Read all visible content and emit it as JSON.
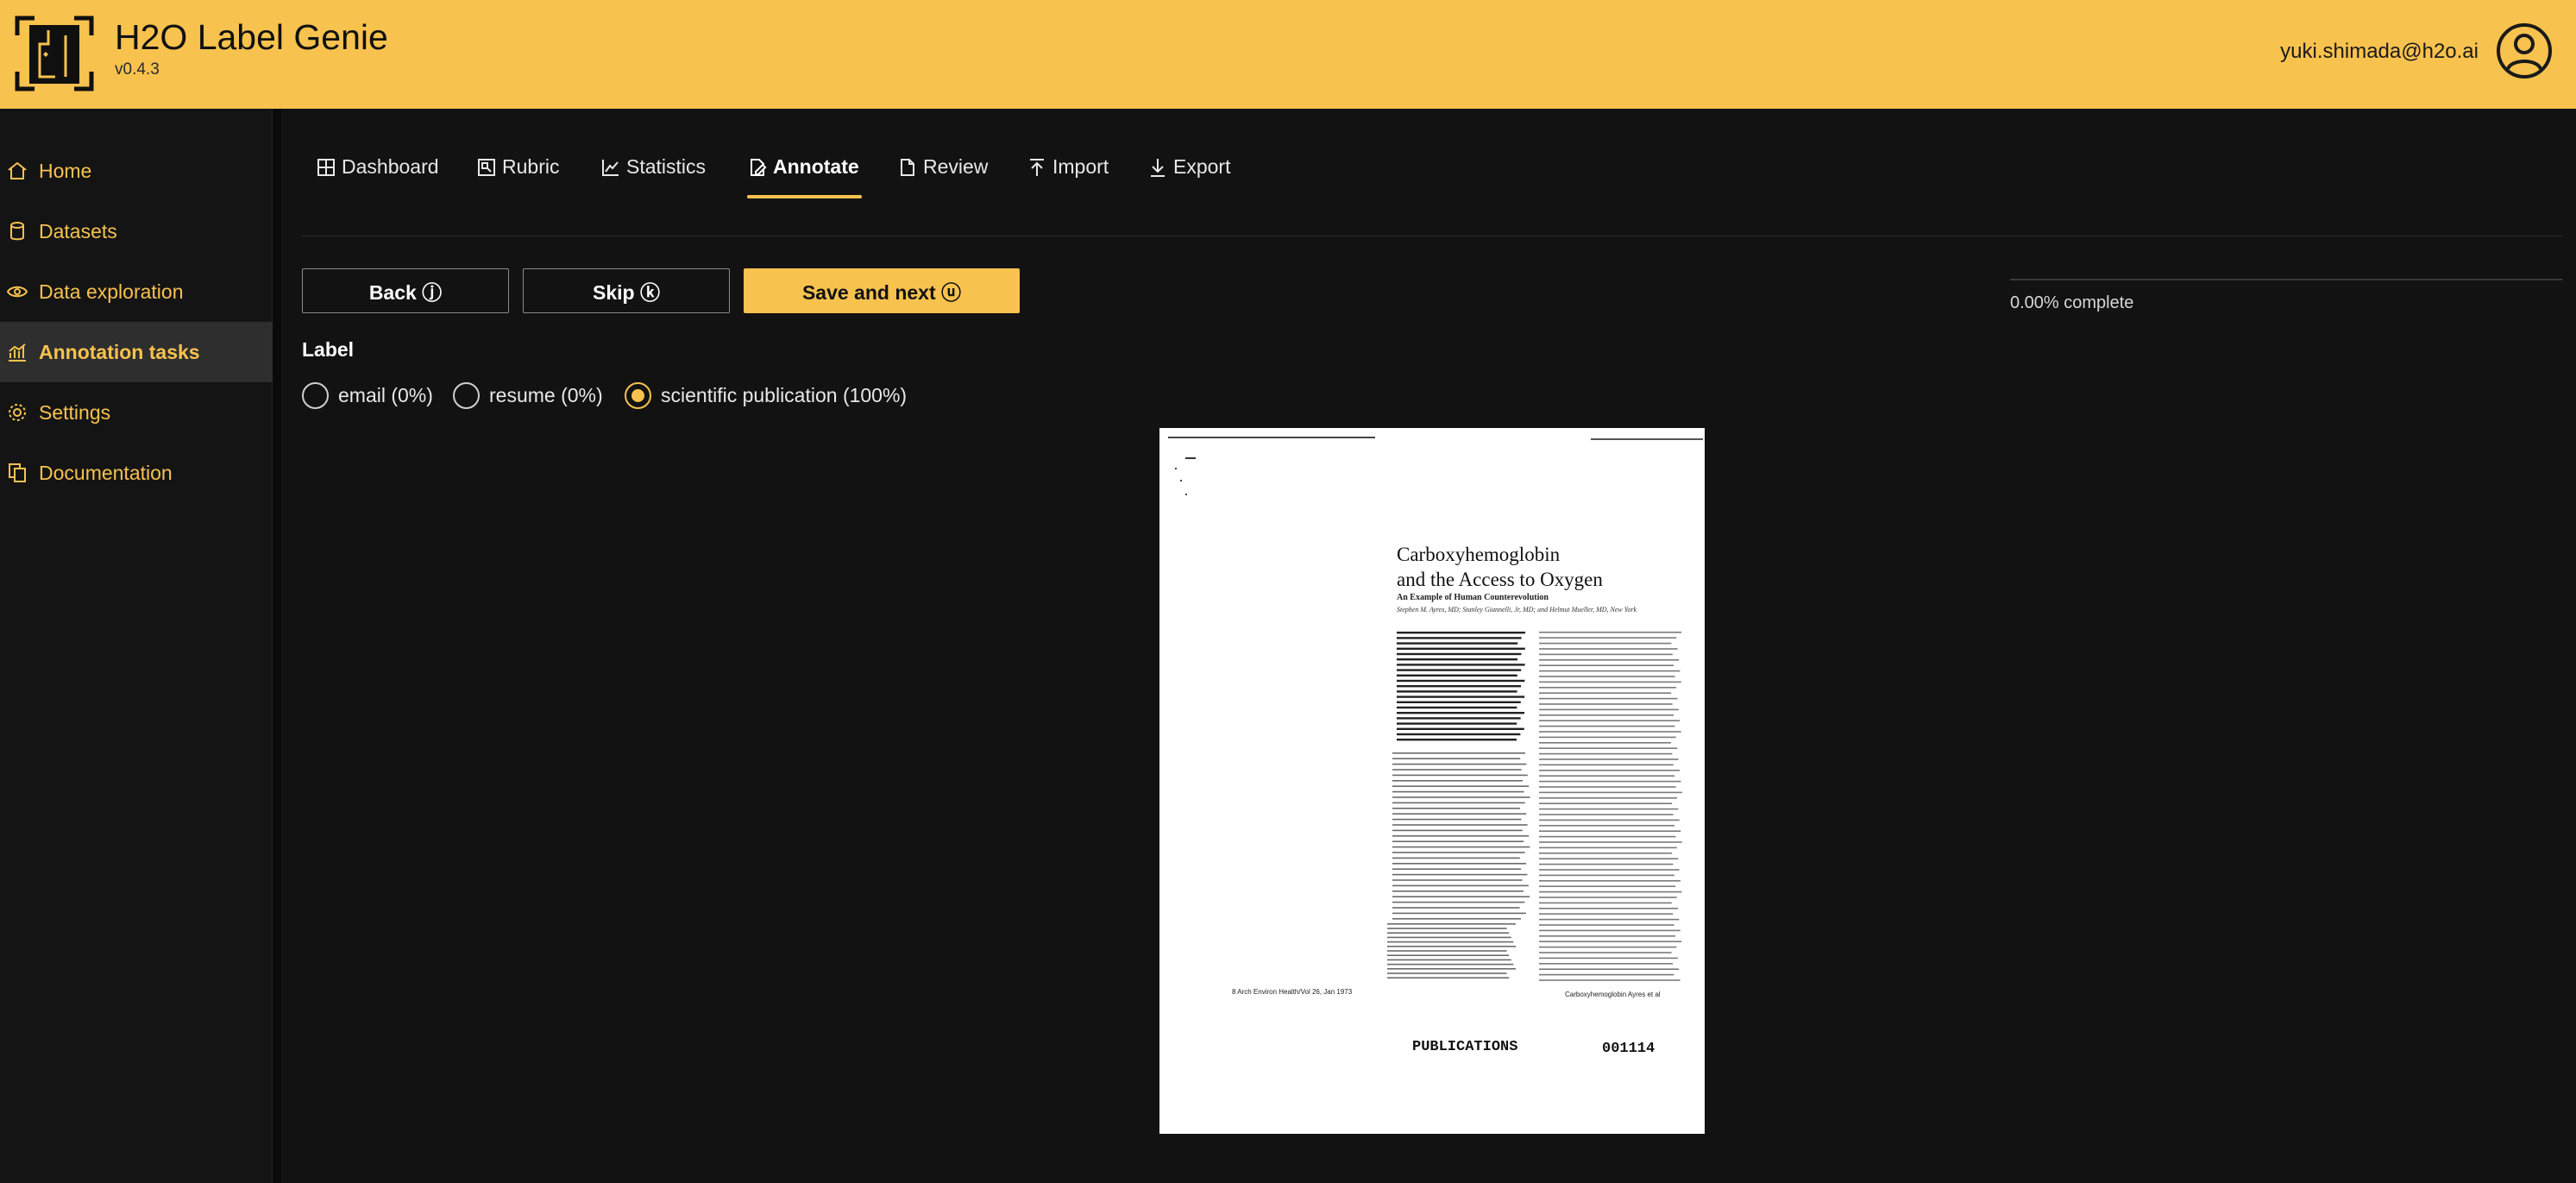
{
  "app": {
    "title": "H2O Label Genie",
    "version": "v0.4.3",
    "user_email": "yuki.shimada@h2o.ai",
    "brand_color": "#f8c24e"
  },
  "sidebar": {
    "items": [
      {
        "label": "Home",
        "icon": "home-icon"
      },
      {
        "label": "Datasets",
        "icon": "database-icon"
      },
      {
        "label": "Data exploration",
        "icon": "eye-icon"
      },
      {
        "label": "Annotation tasks",
        "icon": "chart-icon",
        "active": true
      },
      {
        "label": "Settings",
        "icon": "gear-icon"
      },
      {
        "label": "Documentation",
        "icon": "documents-icon"
      }
    ]
  },
  "tabs": [
    {
      "label": "Dashboard",
      "icon": "dashboard-icon"
    },
    {
      "label": "Rubric",
      "icon": "rubric-icon"
    },
    {
      "label": "Statistics",
      "icon": "line-chart-icon"
    },
    {
      "label": "Annotate",
      "icon": "edit-icon",
      "active": true
    },
    {
      "label": "Review",
      "icon": "document-icon"
    },
    {
      "label": "Import",
      "icon": "upload-icon"
    },
    {
      "label": "Export",
      "icon": "download-icon"
    }
  ],
  "actions": {
    "back_label": "Back ⓙ",
    "skip_label": "Skip ⓚ",
    "save_next_label": "Save and next ⓤ"
  },
  "progress": {
    "fraction": 0.0,
    "text": "0.00% complete"
  },
  "label_section": {
    "heading": "Label",
    "options": [
      {
        "label": "email (0%)",
        "checked": false
      },
      {
        "label": "resume (0%)",
        "checked": false
      },
      {
        "label": "scientific publication (100%)",
        "checked": true
      }
    ]
  },
  "document": {
    "title_line1": "Carboxyhemoglobin",
    "title_line2": "and the Access to Oxygen",
    "subtitle": "An Example of Human Counterevolution",
    "authors": "Stephen M. Ayres, MD; Stanley Giannelli, Jr, MD; and Helmut Mueller, MD, New York",
    "footer_left": "8 Arch Environ Health/Vol 26, Jan 1973",
    "footer_right": "Carboxyhemoglobin Ayres et al",
    "stamp_left": "PUBLICATIONS",
    "stamp_right": "001114"
  }
}
